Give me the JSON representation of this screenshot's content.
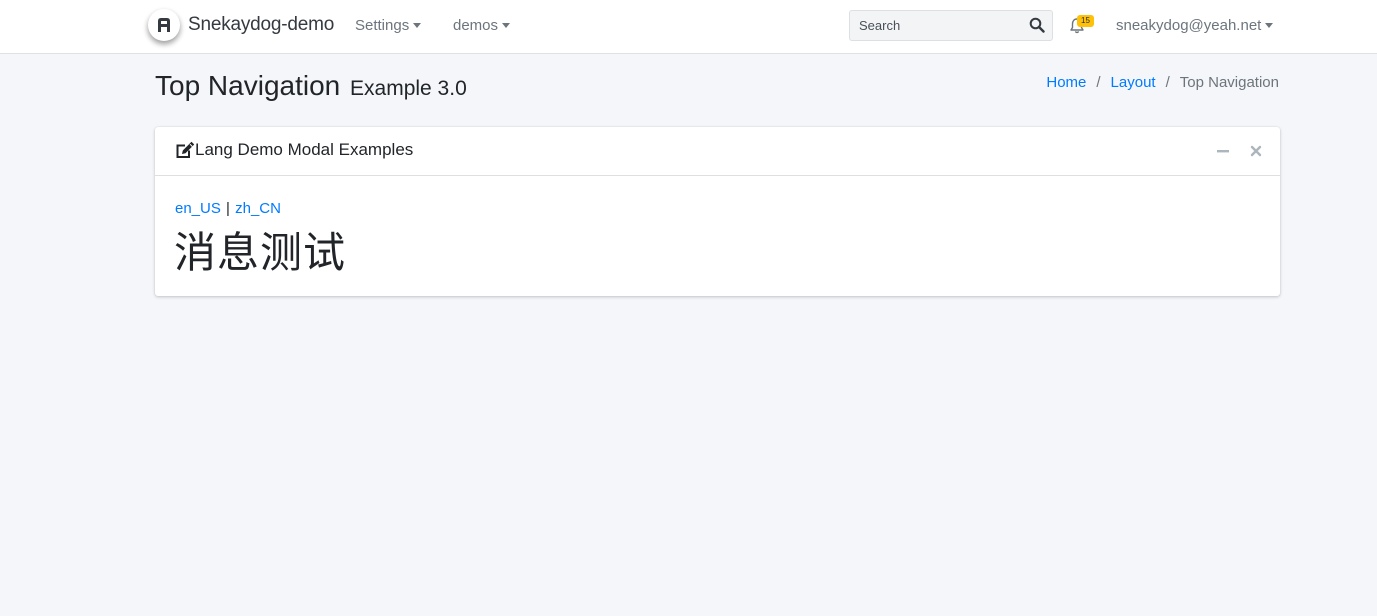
{
  "navbar": {
    "brand": "Snekaydog-demo",
    "menus": [
      {
        "label": "Settings"
      },
      {
        "label": "demos"
      }
    ],
    "search": {
      "placeholder": "Search",
      "value": ""
    },
    "notifications": {
      "count": "15",
      "icon": "bell-icon"
    },
    "user": "sneakydog@yeah.net"
  },
  "header": {
    "title": "Top Navigation",
    "subtitle": "Example 3.0",
    "breadcrumb": [
      {
        "label": "Home"
      },
      {
        "label": "Layout"
      },
      {
        "label": "Top Navigation"
      }
    ]
  },
  "card": {
    "title": "Lang Demo Modal Examples",
    "langs": [
      "en_US",
      "zh_CN"
    ],
    "separator": "|",
    "message": "消息测试"
  },
  "colors": {
    "link": "#007bff",
    "badge": "#ffc107",
    "background": "#f4f6f9"
  }
}
